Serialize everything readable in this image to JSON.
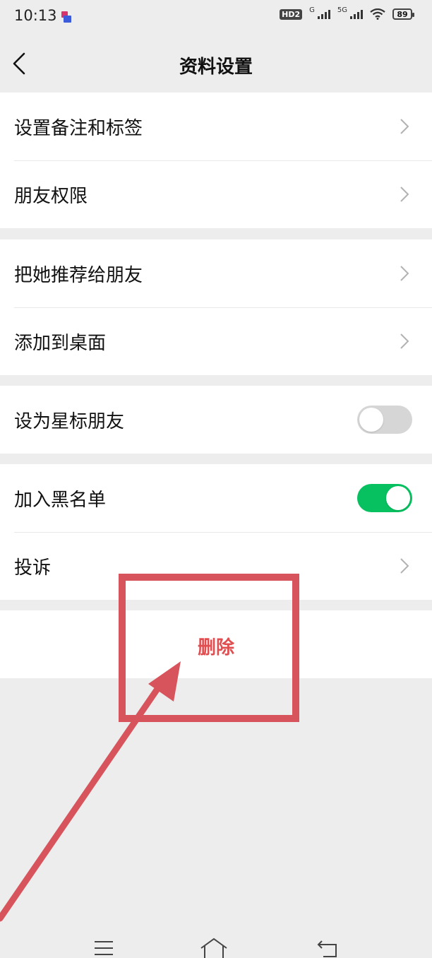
{
  "status_bar": {
    "time": "10:13",
    "hd_badge": "HD2",
    "network_1": "G",
    "network_2": "5G",
    "battery": "89"
  },
  "header": {
    "title": "资料设置",
    "back_icon": "chevron-left-icon"
  },
  "groups": [
    {
      "rows": [
        {
          "label": "设置备注和标签",
          "type": "chevron"
        },
        {
          "label": "朋友权限",
          "type": "chevron"
        }
      ]
    },
    {
      "rows": [
        {
          "label": "把她推荐给朋友",
          "type": "chevron"
        },
        {
          "label": "添加到桌面",
          "type": "chevron"
        }
      ]
    },
    {
      "rows": [
        {
          "label": "设为星标朋友",
          "type": "toggle",
          "on": false
        }
      ]
    },
    {
      "rows": [
        {
          "label": "加入黑名单",
          "type": "toggle",
          "on": true
        },
        {
          "label": "投诉",
          "type": "chevron"
        }
      ]
    }
  ],
  "delete_label": "删除",
  "colors": {
    "background": "#ededed",
    "toggle_on": "#07c160",
    "toggle_off": "#d6d6d6",
    "delete_text": "#e04e50",
    "annotation": "#d8545c"
  },
  "bottom_nav": {
    "menu_icon": "menu-icon",
    "home_icon": "home-icon",
    "back_icon": "back-arrow-icon"
  }
}
